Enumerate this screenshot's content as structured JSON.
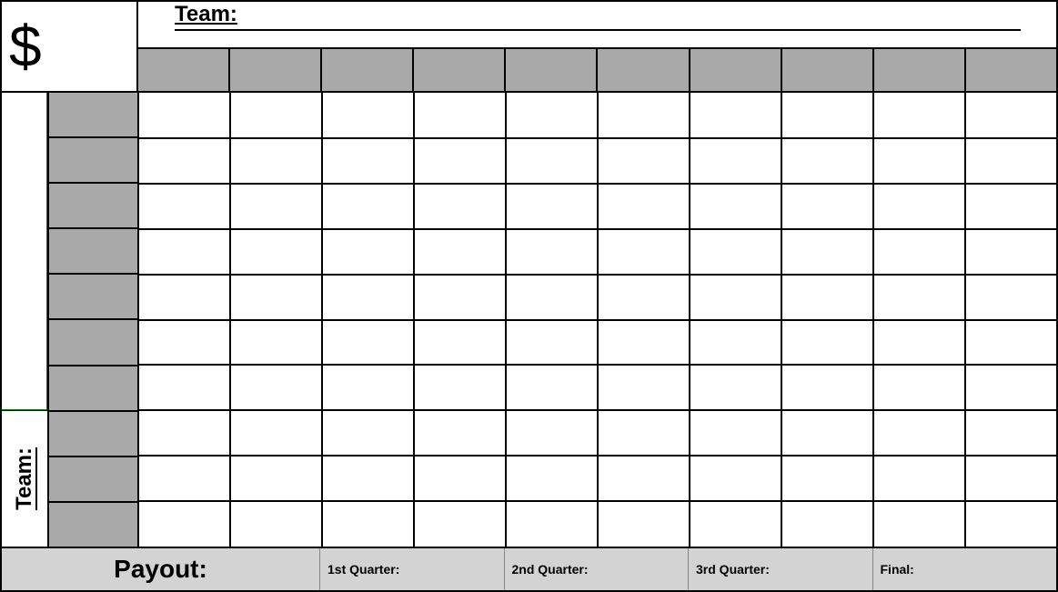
{
  "header": {
    "dollar_sign": "$",
    "team_top_label": "Team:",
    "team_left_label": "Team:"
  },
  "grid": {
    "columns": 10,
    "rows": 10,
    "top_numbers": [
      "",
      "",
      "",
      "",
      "",
      "",
      "",
      "",
      "",
      ""
    ],
    "left_numbers": [
      "",
      "",
      "",
      "",
      "",
      "",
      "",
      "",
      "",
      ""
    ],
    "cells": []
  },
  "payout": {
    "label": "Payout:",
    "quarters": [
      {
        "label": "1st Quarter:",
        "value": ""
      },
      {
        "label": "2nd Quarter:",
        "value": ""
      },
      {
        "label": "3rd Quarter:",
        "value": ""
      },
      {
        "label": "Final:",
        "value": ""
      }
    ]
  }
}
